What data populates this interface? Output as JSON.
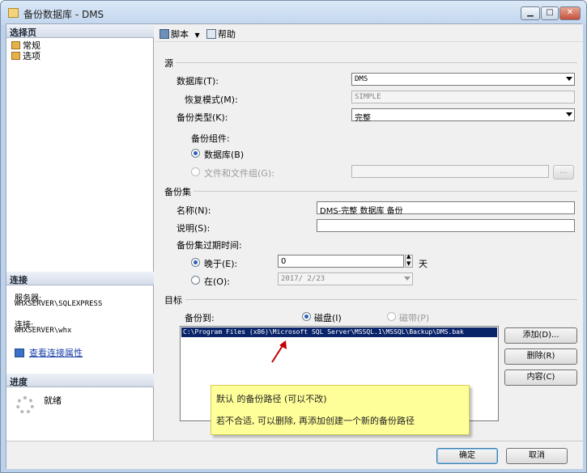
{
  "window": {
    "title": "备份数据库 - DMS",
    "minimize_glyph": "▁",
    "maximize_glyph": "□",
    "close_glyph": "✕"
  },
  "left": {
    "select_page_header": "选择页",
    "pages": [
      {
        "label": "常规",
        "icon": "page-icon"
      },
      {
        "label": "选项",
        "icon": "page-icon"
      }
    ],
    "connection_header": "连接",
    "server_label": "服务器:",
    "server_value": "WHXSERVER\\SQLEXPRESS",
    "connection_label": "连接:",
    "connection_value": "WHXSERVER\\whx",
    "view_connection_link": "查看连接属性",
    "progress_header": "进度",
    "progress_status": "就绪"
  },
  "toolbar": {
    "script_label": "脚本",
    "help_label": "帮助"
  },
  "source": {
    "group_label": "源",
    "database_label": "数据库(T):",
    "database_value": "DMS",
    "recovery_label": "恢复模式(M):",
    "recovery_value": "SIMPLE",
    "backup_type_label": "备份类型(K):",
    "backup_type_value": "完整",
    "component_label": "备份组件:",
    "radio_database": "数据库(B)",
    "radio_files": "文件和文件组(G):",
    "browse_button": "..."
  },
  "backup_set": {
    "group_label": "备份集",
    "name_label": "名称(N):",
    "name_value": "DMS-完整 数据库 备份",
    "description_label": "说明(S):",
    "description_value": "",
    "expire_label": "备份集过期时间:",
    "after_label": "晚于(E):",
    "after_value": "0",
    "days_label": "天",
    "on_label": "在(O):",
    "on_value": "2017/ 2/23"
  },
  "destination": {
    "group_label": "目标",
    "backup_to_label": "备份到:",
    "disk_label": "磁盘(I)",
    "tape_label": "磁带(P)",
    "path": "C:\\Program Files (x86)\\Microsoft SQL Server\\MSSQL.1\\MSSQL\\Backup\\DMS.bak",
    "add_button": "添加(D)...",
    "remove_button": "删除(R)",
    "contents_button": "内容(C)"
  },
  "callout": {
    "line1": "默认 的备份路径 (可以不改)",
    "line2": "若不合适, 可以删除, 再添加创建一个新的备份路径"
  },
  "footer": {
    "ok_button": "确定",
    "cancel_button": "取消"
  },
  "colors": {
    "selection": "#0a246a",
    "callout_bg": "#ffff99",
    "arrow": "#c00000",
    "link": "#1a3fa8"
  }
}
